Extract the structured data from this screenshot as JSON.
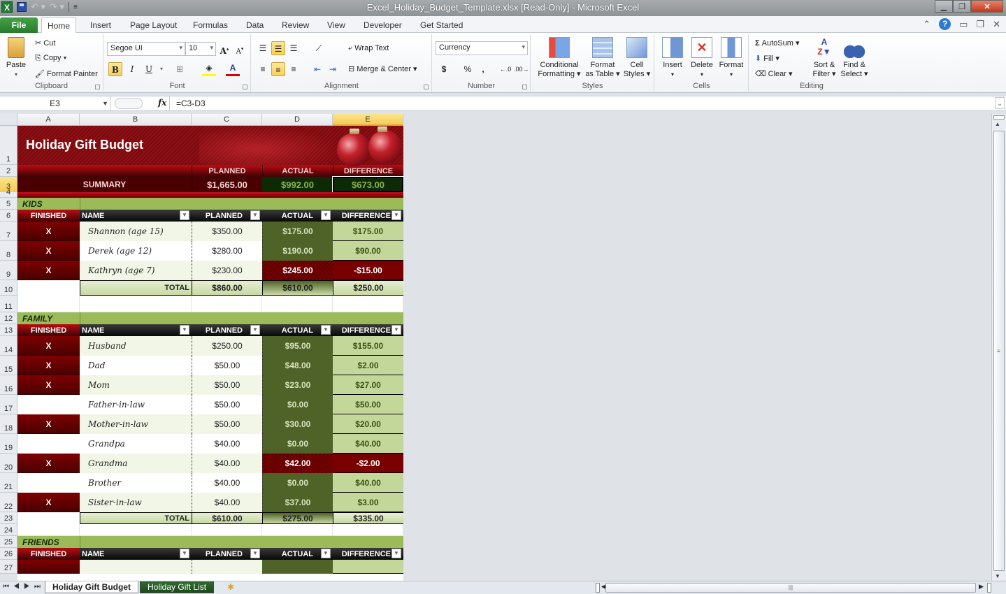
{
  "window": {
    "title": "Excel_Holiday_Budget_Template.xlsx  [Read-Only]  -  Microsoft Excel",
    "app_icon": "excel-icon",
    "controls": [
      "minimize-icon",
      "restore-icon",
      "close-icon"
    ]
  },
  "ribbon_tabs": [
    "File",
    "Home",
    "Insert",
    "Page Layout",
    "Formulas",
    "Data",
    "Review",
    "View",
    "Developer",
    "Get Started"
  ],
  "active_tab": "Home",
  "ribbon": {
    "clipboard": {
      "label": "Clipboard",
      "paste": "Paste",
      "cut": "Cut",
      "copy": "Copy",
      "format_painter": "Format Painter"
    },
    "font": {
      "label": "Font",
      "font_name": "Segoe UI",
      "font_size": "10",
      "bold": "B",
      "italic": "I",
      "underline": "U"
    },
    "alignment": {
      "label": "Alignment",
      "wrap_text": "Wrap Text",
      "merge_center": "Merge & Center"
    },
    "number": {
      "label": "Number",
      "format": "Currency",
      "dollar": "$",
      "percent": "%",
      "comma": ","
    },
    "styles": {
      "label": "Styles",
      "conditional": [
        "Conditional",
        "Formatting ▾"
      ],
      "format_table": [
        "Format",
        "as Table ▾"
      ],
      "cell_styles": [
        "Cell",
        "Styles ▾"
      ]
    },
    "cells": {
      "label": "Cells",
      "insert": "Insert",
      "delete": "Delete",
      "format": "Format"
    },
    "editing": {
      "label": "Editing",
      "autosum": "AutoSum",
      "fill": "Fill",
      "clear": "Clear",
      "sort": [
        "Sort &",
        "Filter ▾"
      ],
      "find": [
        "Find &",
        "Select ▾"
      ]
    }
  },
  "formula_bar": {
    "name_box": "E3",
    "fx": "fx",
    "formula": "=C3-D3"
  },
  "columns": [
    "A",
    "B",
    "C",
    "D",
    "E"
  ],
  "selected_column": "E",
  "selected_row": "3",
  "sheet": {
    "title": "Holiday Gift Budget",
    "summary": {
      "headers": [
        "PLANNED",
        "ACTUAL",
        "DIFFERENCE"
      ],
      "label": "SUMMARY",
      "planned": "$1,665.00",
      "actual": "$992.00",
      "difference": "$673.00"
    },
    "table_headers": [
      "FINISHED",
      "NAME",
      "PLANNED",
      "ACTUAL",
      "DIFFERENCE"
    ],
    "total_label": "TOTAL",
    "sections": [
      {
        "name": "KIDS",
        "rows": [
          {
            "finished": "X",
            "name": "Shannon (age 15)",
            "planned": "$350.00",
            "actual": "$175.00",
            "difference": "$175.00",
            "over": false
          },
          {
            "finished": "X",
            "name": "Derek (age 12)",
            "planned": "$280.00",
            "actual": "$190.00",
            "difference": "$90.00",
            "over": false
          },
          {
            "finished": "X",
            "name": "Kathryn (age 7)",
            "planned": "$230.00",
            "actual": "$245.00",
            "difference": "-$15.00",
            "over": true
          }
        ],
        "total": {
          "planned": "$860.00",
          "actual": "$610.00",
          "difference": "$250.00"
        }
      },
      {
        "name": "FAMILY",
        "rows": [
          {
            "finished": "X",
            "name": "Husband",
            "planned": "$250.00",
            "actual": "$95.00",
            "difference": "$155.00",
            "over": false
          },
          {
            "finished": "X",
            "name": "Dad",
            "planned": "$50.00",
            "actual": "$48.00",
            "difference": "$2.00",
            "over": false
          },
          {
            "finished": "X",
            "name": "Mom",
            "planned": "$50.00",
            "actual": "$23.00",
            "difference": "$27.00",
            "over": false
          },
          {
            "finished": "",
            "name": "Father-in-law",
            "planned": "$50.00",
            "actual": "$0.00",
            "difference": "$50.00",
            "over": false
          },
          {
            "finished": "X",
            "name": "Mother-in-law",
            "planned": "$50.00",
            "actual": "$30.00",
            "difference": "$20.00",
            "over": false
          },
          {
            "finished": "",
            "name": "Grandpa",
            "planned": "$40.00",
            "actual": "$0.00",
            "difference": "$40.00",
            "over": false
          },
          {
            "finished": "X",
            "name": "Grandma",
            "planned": "$40.00",
            "actual": "$42.00",
            "difference": "-$2.00",
            "over": true
          },
          {
            "finished": "",
            "name": "Brother",
            "planned": "$40.00",
            "actual": "$0.00",
            "difference": "$40.00",
            "over": false
          },
          {
            "finished": "X",
            "name": "Sister-in-law",
            "planned": "$40.00",
            "actual": "$37.00",
            "difference": "$3.00",
            "over": false
          }
        ],
        "total": {
          "planned": "$610.00",
          "actual": "$275.00",
          "difference": "$335.00"
        }
      },
      {
        "name": "FRIENDS",
        "rows": [],
        "total": null
      }
    ]
  },
  "sheet_tabs": [
    "Holiday Gift Budget",
    "Holiday Gift List"
  ],
  "active_sheet": "Holiday Gift Budget"
}
